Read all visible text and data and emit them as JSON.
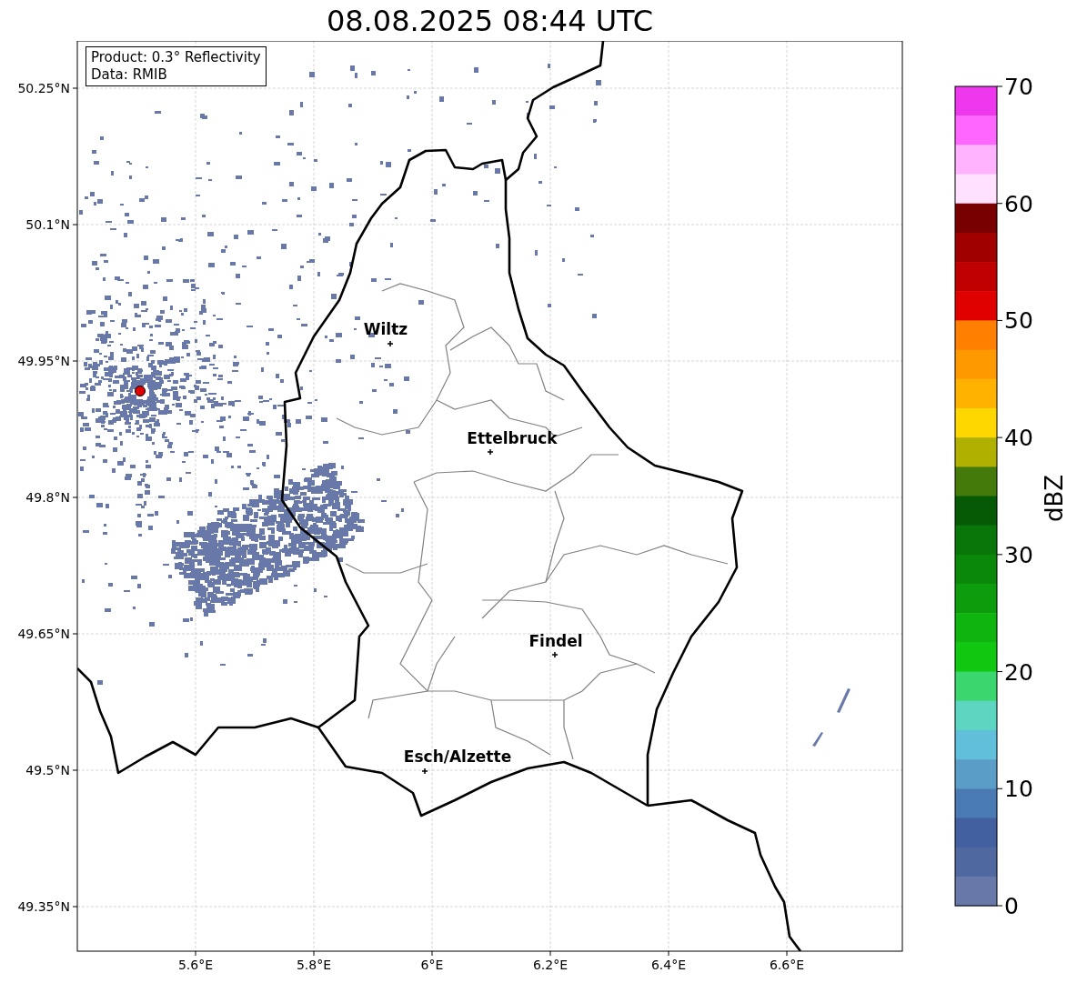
{
  "title": "08.08.2025 08:44 UTC",
  "info_box": {
    "lines": [
      "Product: 0.3° Reflectivity",
      "Data: RMIB"
    ]
  },
  "map": {
    "x_ticks": [
      "5.6°E",
      "5.8°E",
      "6°E",
      "6.2°E",
      "6.4°E",
      "6.6°E"
    ],
    "y_ticks": [
      "50.25°N",
      "50.1°N",
      "49.95°N",
      "49.8°N",
      "49.65°N",
      "49.5°N",
      "49.35°N"
    ],
    "places": [
      {
        "name": "Wiltz"
      },
      {
        "name": "Ettelbruck"
      },
      {
        "name": "Findel"
      },
      {
        "name": "Esch/Alzette"
      }
    ]
  },
  "colorbar": {
    "label": "dBZ",
    "ticks": [
      "70",
      "60",
      "50",
      "40",
      "30",
      "20",
      "10",
      "0"
    ],
    "bins": [
      {
        "color": "#ee38ee"
      },
      {
        "color": "#ff66ff"
      },
      {
        "color": "#ffb3ff"
      },
      {
        "color": "#ffe0ff"
      },
      {
        "color": "#780000"
      },
      {
        "color": "#a00000"
      },
      {
        "color": "#c00000"
      },
      {
        "color": "#e00000"
      },
      {
        "color": "#ff7f00"
      },
      {
        "color": "#ff9900"
      },
      {
        "color": "#ffb300"
      },
      {
        "color": "#ffd700"
      },
      {
        "color": "#b0b000"
      },
      {
        "color": "#447a0a"
      },
      {
        "color": "#065a06"
      },
      {
        "color": "#087608"
      },
      {
        "color": "#0a880a"
      },
      {
        "color": "#0c9c0c"
      },
      {
        "color": "#0fb40f"
      },
      {
        "color": "#11c811"
      },
      {
        "color": "#3cd66e"
      },
      {
        "color": "#5cd6c0"
      },
      {
        "color": "#60c0dc"
      },
      {
        "color": "#5a9ec8"
      },
      {
        "color": "#4a7ab4"
      },
      {
        "color": "#4260a0"
      },
      {
        "color": "#5068a0"
      },
      {
        "color": "#6878a8"
      }
    ]
  }
}
